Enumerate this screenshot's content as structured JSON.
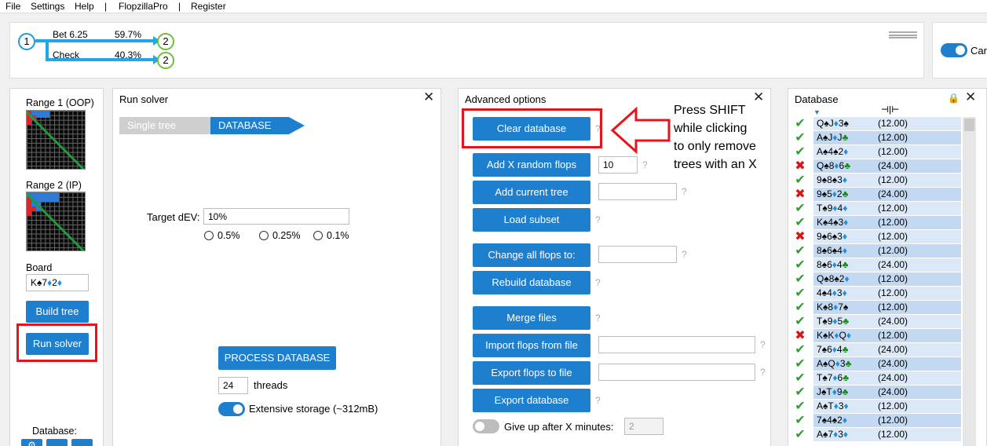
{
  "menu": {
    "file": "File",
    "settings": "Settings",
    "help": "Help",
    "sep1": "|",
    "flopzilla": "FlopzillaPro",
    "sep2": "|",
    "register": "Register"
  },
  "tree": {
    "root_node": "1",
    "bet_label": "Bet 6.25",
    "bet_pct": "59.7%",
    "check_label": "Check",
    "check_pct": "40.3%",
    "child_node_1": "2",
    "child_node_2": "2"
  },
  "right_toggle_label": "Car",
  "left_sidebar": {
    "range1_label": "Range 1 (OOP)",
    "range2_label": "Range 2 (IP)",
    "board_label": "Board",
    "board_value": [
      {
        "t": "K",
        "s": "♠",
        "c": "sp"
      },
      {
        "t": "7",
        "s": "♦",
        "c": "dm"
      },
      {
        "t": "2",
        "s": "♦",
        "c": "dm"
      }
    ],
    "build_tree": "Build tree",
    "run_solver": "Run solver",
    "database_label": "Database:"
  },
  "run_solver_panel": {
    "title": "Run solver",
    "close": "✕",
    "tab_single": "Single tree",
    "tab_database": "DATABASE",
    "target_dev_label": "Target dEV:",
    "target_dev_value": "10%",
    "radio_1": "0.5%",
    "radio_2": "0.25%",
    "radio_3": "0.1%",
    "process_button": "PROCESS DATABASE",
    "threads_value": "24",
    "threads_label": "threads",
    "extensive_label": "Extensive storage (~312mB)"
  },
  "advanced_panel": {
    "title": "Advanced options",
    "close": "✕",
    "clear_database": "Clear database",
    "add_random": "Add X random flops",
    "add_random_value": "10",
    "add_current": "Add current tree",
    "load_subset": "Load subset",
    "change_all": "Change all flops to:",
    "rebuild": "Rebuild database",
    "merge": "Merge files",
    "import": "Import flops from file",
    "export_flops": "Export flops to file",
    "export_db": "Export database",
    "give_up_label": "Give up after X minutes:",
    "give_up_value": "2",
    "q": "?"
  },
  "annotation": {
    "line1": "Press SHIFT",
    "line2": "while clicking",
    "line3": "to only remove",
    "line4": "trees with an X"
  },
  "database_panel": {
    "title": "Database",
    "close": "✕",
    "sort_icon": "▼",
    "weight_icon": "⊣|⊢",
    "rows": [
      {
        "mark": "check",
        "cards": [
          [
            "Q",
            "♠",
            "sp"
          ],
          [
            "J",
            "♦",
            "dm"
          ],
          [
            "3",
            "♠",
            "sp"
          ]
        ],
        "value": "(12.00)"
      },
      {
        "mark": "check",
        "cards": [
          [
            "A",
            "♠",
            "sp"
          ],
          [
            "J",
            "♦",
            "dm"
          ],
          [
            "J",
            "♣",
            "cl"
          ]
        ],
        "value": "(12.00)"
      },
      {
        "mark": "check",
        "cards": [
          [
            "A",
            "♠",
            "sp"
          ],
          [
            "4",
            "♠",
            "sp"
          ],
          [
            "2",
            "♦",
            "dm"
          ]
        ],
        "value": "(12.00)"
      },
      {
        "mark": "x",
        "cards": [
          [
            "Q",
            "♠",
            "sp"
          ],
          [
            "8",
            "♦",
            "dm"
          ],
          [
            "6",
            "♣",
            "cl"
          ]
        ],
        "value": "(24.00)"
      },
      {
        "mark": "check",
        "cards": [
          [
            "9",
            "♠",
            "sp"
          ],
          [
            "8",
            "♠",
            "sp"
          ],
          [
            "3",
            "♦",
            "dm"
          ]
        ],
        "value": "(12.00)"
      },
      {
        "mark": "x",
        "cards": [
          [
            "9",
            "♠",
            "sp"
          ],
          [
            "5",
            "♦",
            "dm"
          ],
          [
            "2",
            "♣",
            "cl"
          ]
        ],
        "value": "(24.00)"
      },
      {
        "mark": "check",
        "cards": [
          [
            "T",
            "♠",
            "sp"
          ],
          [
            "9",
            "♦",
            "dm"
          ],
          [
            "4",
            "♦",
            "dm"
          ]
        ],
        "value": "(12.00)"
      },
      {
        "mark": "check",
        "cards": [
          [
            "K",
            "♠",
            "sp"
          ],
          [
            "4",
            "♠",
            "sp"
          ],
          [
            "3",
            "♦",
            "dm"
          ]
        ],
        "value": "(12.00)"
      },
      {
        "mark": "x",
        "cards": [
          [
            "9",
            "♠",
            "sp"
          ],
          [
            "6",
            "♠",
            "sp"
          ],
          [
            "3",
            "♦",
            "dm"
          ]
        ],
        "value": "(12.00)"
      },
      {
        "mark": "check",
        "cards": [
          [
            "8",
            "♠",
            "sp"
          ],
          [
            "6",
            "♠",
            "sp"
          ],
          [
            "4",
            "♦",
            "dm"
          ]
        ],
        "value": "(12.00)"
      },
      {
        "mark": "check",
        "cards": [
          [
            "8",
            "♠",
            "sp"
          ],
          [
            "6",
            "♦",
            "dm"
          ],
          [
            "4",
            "♣",
            "cl"
          ]
        ],
        "value": "(24.00)"
      },
      {
        "mark": "check",
        "cards": [
          [
            "Q",
            "♠",
            "sp"
          ],
          [
            "8",
            "♠",
            "sp"
          ],
          [
            "2",
            "♦",
            "dm"
          ]
        ],
        "value": "(12.00)"
      },
      {
        "mark": "check",
        "cards": [
          [
            "4",
            "♠",
            "sp"
          ],
          [
            "4",
            "♦",
            "dm"
          ],
          [
            "3",
            "♦",
            "dm"
          ]
        ],
        "value": "(12.00)"
      },
      {
        "mark": "check",
        "cards": [
          [
            "K",
            "♠",
            "sp"
          ],
          [
            "8",
            "♦",
            "dm"
          ],
          [
            "7",
            "♠",
            "sp"
          ]
        ],
        "value": "(12.00)"
      },
      {
        "mark": "check",
        "cards": [
          [
            "T",
            "♠",
            "sp"
          ],
          [
            "9",
            "♦",
            "dm"
          ],
          [
            "5",
            "♣",
            "cl"
          ]
        ],
        "value": "(24.00)"
      },
      {
        "mark": "x",
        "cards": [
          [
            "K",
            "♠",
            "sp"
          ],
          [
            "K",
            "♦",
            "dm"
          ],
          [
            "Q",
            "♦",
            "dm"
          ]
        ],
        "value": "(12.00)"
      },
      {
        "mark": "check",
        "cards": [
          [
            "7",
            "♠",
            "sp"
          ],
          [
            "6",
            "♦",
            "dm"
          ],
          [
            "4",
            "♣",
            "cl"
          ]
        ],
        "value": "(24.00)"
      },
      {
        "mark": "check",
        "cards": [
          [
            "A",
            "♠",
            "sp"
          ],
          [
            "Q",
            "♦",
            "dm"
          ],
          [
            "3",
            "♣",
            "cl"
          ]
        ],
        "value": "(24.00)"
      },
      {
        "mark": "check",
        "cards": [
          [
            "T",
            "♠",
            "sp"
          ],
          [
            "7",
            "♦",
            "dm"
          ],
          [
            "6",
            "♣",
            "cl"
          ]
        ],
        "value": "(24.00)"
      },
      {
        "mark": "check",
        "cards": [
          [
            "J",
            "♠",
            "sp"
          ],
          [
            "T",
            "♦",
            "dm"
          ],
          [
            "9",
            "♣",
            "cl"
          ]
        ],
        "value": "(24.00)"
      },
      {
        "mark": "check",
        "cards": [
          [
            "A",
            "♠",
            "sp"
          ],
          [
            "T",
            "♦",
            "dm"
          ],
          [
            "3",
            "♦",
            "dm"
          ]
        ],
        "value": "(12.00)"
      },
      {
        "mark": "check",
        "cards": [
          [
            "7",
            "♠",
            "sp"
          ],
          [
            "4",
            "♠",
            "sp"
          ],
          [
            "2",
            "♦",
            "dm"
          ]
        ],
        "value": "(12.00)"
      },
      {
        "mark": "check",
        "cards": [
          [
            "A",
            "♠",
            "sp"
          ],
          [
            "7",
            "♦",
            "dm"
          ],
          [
            "3",
            "♦",
            "dm"
          ]
        ],
        "value": "(12.00)"
      }
    ]
  },
  "colors": {
    "accent": "#1e7fcf",
    "highlight_red": "#e8141c",
    "tree_line": "#1ea8e8",
    "check": "#2ea02e",
    "x": "#d81414"
  }
}
